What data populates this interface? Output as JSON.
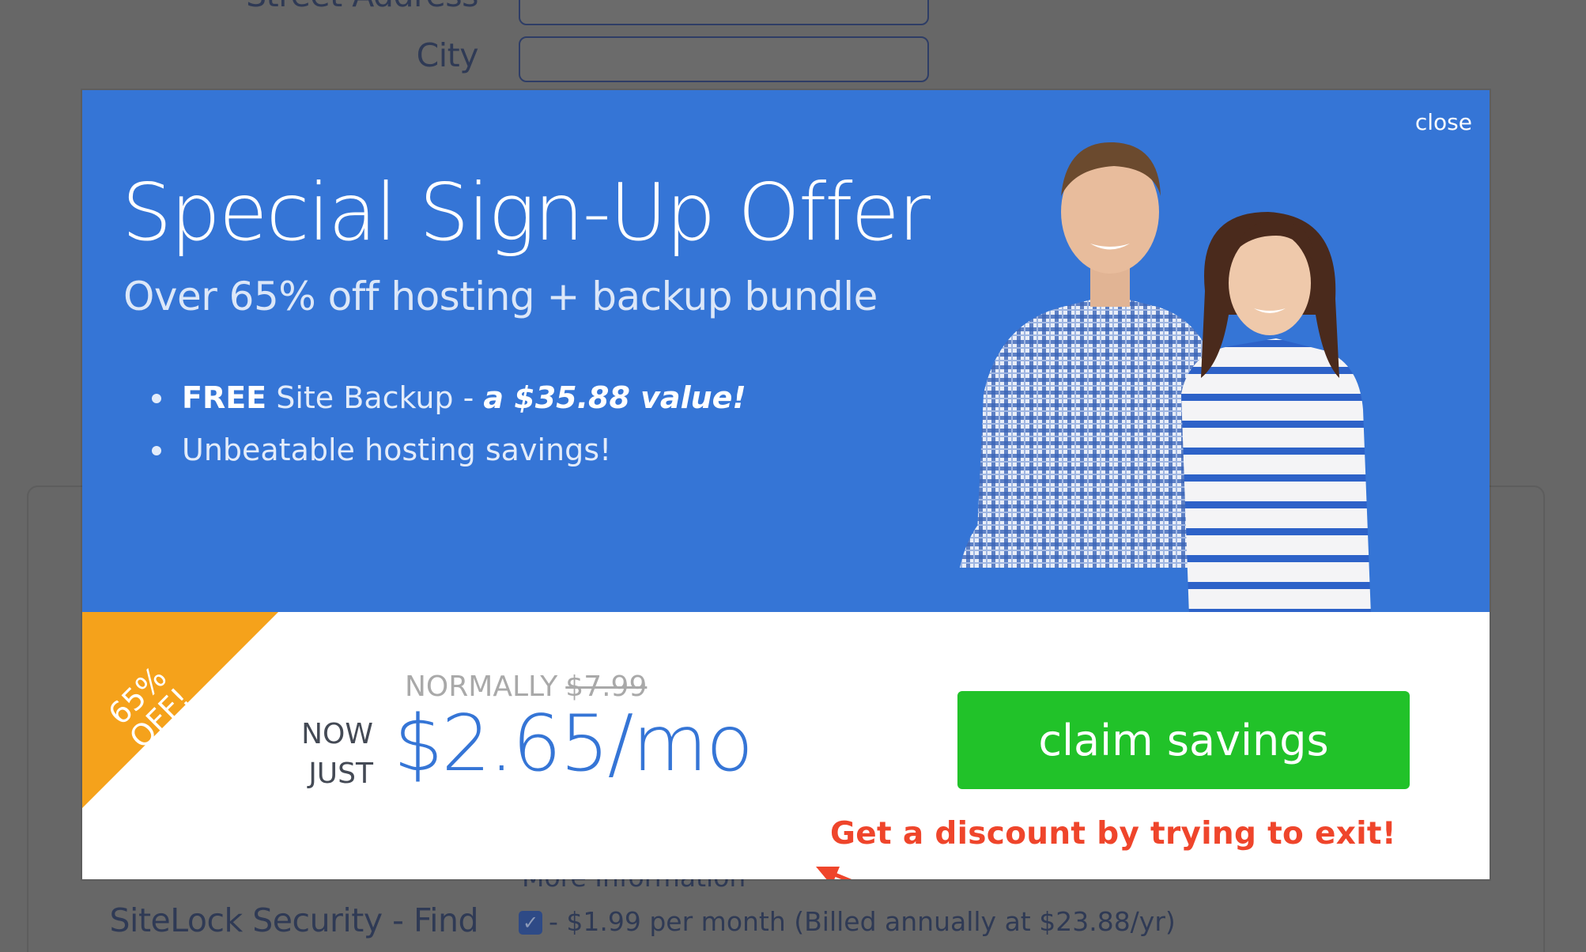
{
  "form": {
    "street_label": "Street Address",
    "city_label": "City",
    "more_info": "More Information",
    "sitelock_label": "SiteLock Security - Find",
    "sitelock_note": "- $1.99 per month (Billed annually at $23.88/yr)",
    "sitelock_checked": true
  },
  "modal": {
    "close": "close",
    "title": "Special Sign-Up Offer",
    "subtitle": "Over 65% off hosting + backup bundle",
    "perk1_strong": "FREE",
    "perk1_text": " Site Backup - ",
    "perk1_value": "a $35.88 value!",
    "perk2": "Unbeatable hosting savings!",
    "ribbon": "65% OFF!",
    "normally_label": "NORMALLY",
    "normally_price": "$7.99",
    "now_just": "NOW JUST",
    "price": "$2.65/mo",
    "cta": "claim savings"
  },
  "annotation": "Get a discount by trying to exit!",
  "colors": {
    "overlay": "#676767",
    "brand_blue": "#3575d6",
    "cta_green": "#21c229",
    "ribbon_orange": "#f5a21b",
    "annotation_red": "#ef452b"
  }
}
